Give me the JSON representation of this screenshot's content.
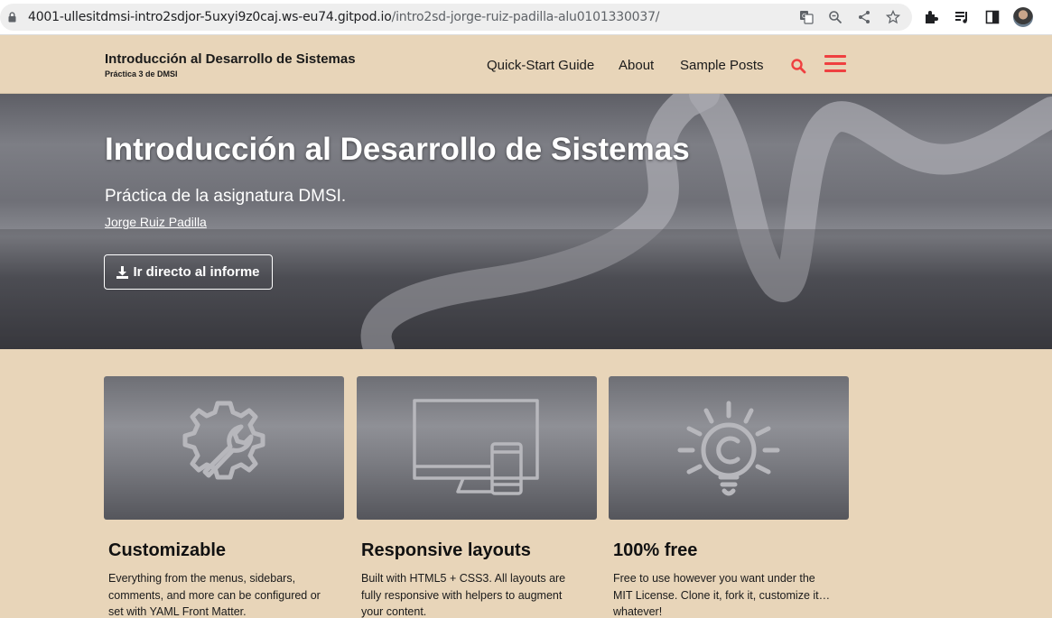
{
  "browser": {
    "url_host": "4001-ullesitdmsi-intro2sdjor-5uxyi9z0caj.ws-eu74.gitpod.io",
    "url_path": "/intro2sd-jorge-ruiz-padilla-alu0101330037/",
    "omnibox_icons": [
      "translate-icon",
      "zoom-icon",
      "share-icon",
      "bookmark-star-icon"
    ],
    "toolbar_icons": [
      "extensions-icon",
      "media-control-icon",
      "side-panel-icon",
      "profile-avatar"
    ]
  },
  "header": {
    "title": "Introducción al Desarrollo de Sistemas",
    "subtitle": "Práctica 3 de DMSI",
    "nav": [
      {
        "label": "Quick-Start Guide"
      },
      {
        "label": "About"
      },
      {
        "label": "Sample Posts"
      }
    ],
    "accent_color": "#ef4040"
  },
  "hero": {
    "title": "Introducción al Desarrollo de Sistemas",
    "subtitle": "Práctica de la asignatura DMSI.",
    "author": "Jorge Ruiz Padilla",
    "button_label": "Ir directo al informe"
  },
  "features": [
    {
      "icon": "wrench-gear-icon",
      "title": "Customizable",
      "text": "Everything from the menus, sidebars, comments, and more can be configured or set with YAML Front Matter."
    },
    {
      "icon": "responsive-devices-icon",
      "title": "Responsive layouts",
      "text": "Built with HTML5 + CSS3. All layouts are fully responsive with helpers to augment your content."
    },
    {
      "icon": "copyright-lightbulb-icon",
      "title": "100% free",
      "text": "Free to use however you want under the MIT License. Clone it, fork it, customize it… whatever!"
    }
  ],
  "colors": {
    "page_background": "#e8d5b9",
    "hero_text": "#ffffff"
  }
}
